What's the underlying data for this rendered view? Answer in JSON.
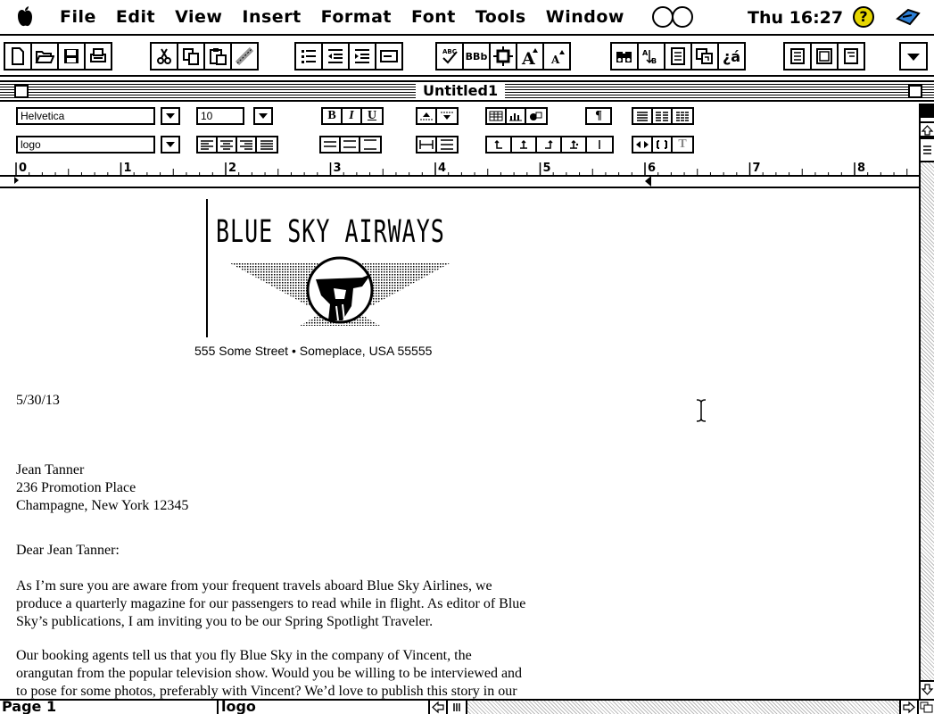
{
  "menubar": {
    "items": [
      "File",
      "Edit",
      "View",
      "Insert",
      "Format",
      "Font",
      "Tools",
      "Window"
    ],
    "clock": "Thu 16:27",
    "help_icon": "?"
  },
  "toolbar": {
    "text_buttons": {
      "spelling": "ABC",
      "small_caps": "BBb",
      "spanish": "¿á"
    }
  },
  "window": {
    "title": "Untitled1"
  },
  "format": {
    "font": "Helvetica",
    "size": "10",
    "style": "logo",
    "bold": "B",
    "italic": "I",
    "underline": "U",
    "superscript_text": "T"
  },
  "ruler": {
    "labels": [
      "0",
      "1",
      "2",
      "3",
      "4",
      "5",
      "6",
      "7",
      "8"
    ]
  },
  "document": {
    "logo_text": "BLUE SKY AIRWAYS",
    "address": "555 Some Street • Someplace, USA 55555",
    "date": "5/30/13",
    "recipient": [
      "Jean Tanner",
      "236 Promotion Place",
      "Champagne, New York 12345"
    ],
    "salutation": "Dear Jean Tanner:",
    "paragraph1": [
      "As I’m sure you are aware from your frequent travels aboard Blue Sky Airlines, we",
      "produce a quarterly magazine for our passengers to read while in flight. As editor of Blue",
      "Sky’s publications, I am inviting you to be our Spring Spotlight Traveler."
    ],
    "paragraph2": [
      "Our booking agents tell us that you fly Blue Sky in the company of Vincent, the",
      "orangutan from the popular television show. Would you be willing to be interviewed and",
      "to pose for some photos, preferably with Vincent? We’d love to publish this story in our"
    ]
  },
  "status": {
    "page": "Page 1",
    "style": "logo"
  }
}
